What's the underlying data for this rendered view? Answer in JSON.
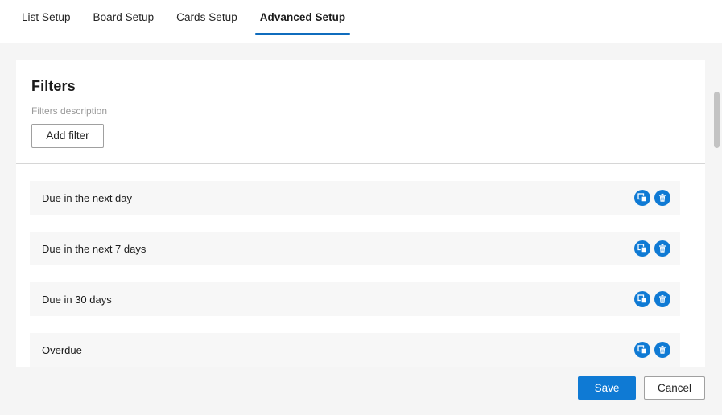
{
  "tabs": [
    {
      "label": "List Setup",
      "active": false
    },
    {
      "label": "Board Setup",
      "active": false
    },
    {
      "label": "Cards Setup",
      "active": false
    },
    {
      "label": "Advanced Setup",
      "active": true
    }
  ],
  "card": {
    "title": "Filters",
    "description": "Filters description",
    "add_button": "Add filter"
  },
  "filters": [
    {
      "label": "Due in the next day"
    },
    {
      "label": "Due in the next 7 days"
    },
    {
      "label": "Due in 30 days"
    },
    {
      "label": "Overdue"
    }
  ],
  "row_actions": {
    "duplicate_icon": "copy-icon",
    "delete_icon": "trash-icon"
  },
  "footer": {
    "save_label": "Save",
    "cancel_label": "Cancel"
  },
  "colors": {
    "accent": "#0f6cbd",
    "icon_button": "#0f7ad4",
    "page_background": "#f5f5f5",
    "row_background": "#f7f7f7"
  }
}
